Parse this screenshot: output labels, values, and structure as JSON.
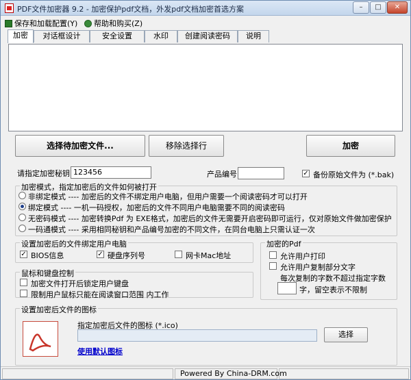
{
  "window": {
    "title": "PDF文件加密器 9.2 - 加密保护pdf文档，外发pdf文档加密首选方案",
    "minimize": "–",
    "maximize": "□",
    "close": "✕"
  },
  "menu": {
    "items": [
      {
        "label": "保存和加载配置(Y)",
        "icon": "save-icon"
      },
      {
        "label": "帮助和购买(Z)",
        "icon": "help-icon"
      }
    ]
  },
  "tabs": [
    {
      "label": "加密",
      "active": true
    },
    {
      "label": "对话框设计"
    },
    {
      "label": "安全设置"
    },
    {
      "label": "水印"
    },
    {
      "label": "创建阅读密码"
    },
    {
      "label": "说明"
    }
  ],
  "buttons": {
    "select_files": "选择待加密文件...",
    "remove_selected": "移除选择行",
    "encrypt": "加密"
  },
  "key": {
    "label": "请指定加密秘钥",
    "value": "123456"
  },
  "product": {
    "label": "产品编号",
    "value": ""
  },
  "backup": {
    "label": "备份原始文件为 (*.bak)",
    "checked": true
  },
  "mode": {
    "title": "加密模式，指定加密后的文件如何被打开",
    "options": [
      {
        "label": "非绑定模式 ---- 加密后的文件不绑定用户电脑，但用户需要一个阅读密码才可以打开",
        "selected": false
      },
      {
        "label": "绑定模式 ---- 一机一码授权，加密后的文件不同用户电脑需要不同的阅读密码",
        "selected": true
      },
      {
        "label": "无密码模式 ---- 加密转换Pdf 为 EXE格式，加密后的文件无需要开启密码即可运行，仅对原始文件做加密保护",
        "selected": false
      },
      {
        "label": "一码通模式 ---- 采用相同秘钥和产品编号加密的不同文件，在同台电脑上只需认证一次",
        "selected": false
      }
    ]
  },
  "bind": {
    "title": "设置加密后的文件绑定用户电脑",
    "options": [
      {
        "label": "BIOS信息",
        "checked": true
      },
      {
        "label": "硬盘序列号",
        "checked": true
      },
      {
        "label": "网卡Mac地址",
        "checked": false
      }
    ]
  },
  "pdf": {
    "title": "加密的Pdf",
    "allow_print": "允许用户打印",
    "allow_copy": "允许用户复制部分文字",
    "copy_limit_line1": "每次复制的字数不超过指定字数",
    "copy_limit_value": "",
    "copy_limit_line2": "字，留空表示不限制"
  },
  "mouse": {
    "title": "鼠标和键盘控制",
    "lock_keyboard": "加密文件打开后锁定用户键盘",
    "limit_mouse": "限制用户鼠标只能在阅读窗口范围 内工作"
  },
  "icon_group": {
    "title": "设置加密后文件的图标",
    "label": "指定加密后文件的图标 (*.ico)",
    "path": "",
    "browse": "选择",
    "use_default": "使用默认图标"
  },
  "status": {
    "text": "Powered By China-DRM.com"
  }
}
